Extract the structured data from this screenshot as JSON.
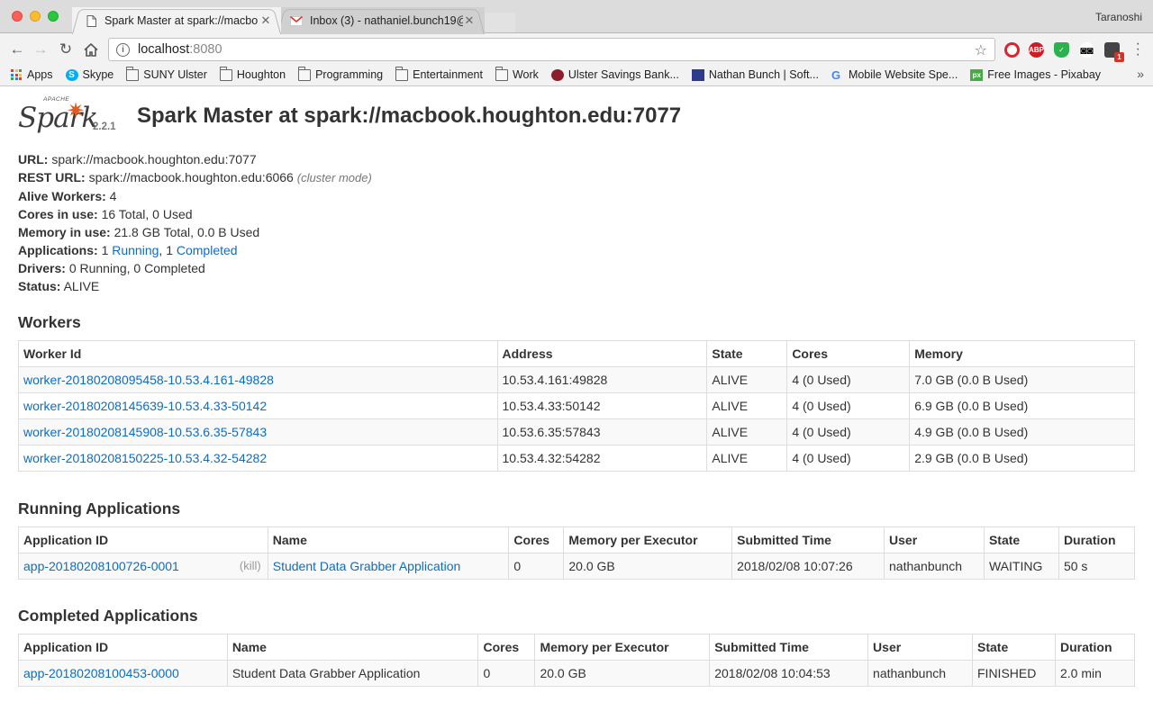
{
  "browser": {
    "tabs": [
      {
        "title": "Spark Master at spark://macbo",
        "favicon": "page-icon"
      },
      {
        "title": "Inbox (3) - nathaniel.bunch19@",
        "favicon": "gmail-icon"
      }
    ],
    "profile_name": "Taranoshi",
    "address": {
      "host": "localhost",
      "port": ":8080"
    },
    "bookmarks": [
      {
        "label": "Apps",
        "icon": "apps-grid-icon"
      },
      {
        "label": "Skype",
        "icon": "skype-icon"
      },
      {
        "label": "SUNY Ulster",
        "icon": "folder-icon"
      },
      {
        "label": "Houghton",
        "icon": "folder-icon"
      },
      {
        "label": "Programming",
        "icon": "folder-icon"
      },
      {
        "label": "Entertainment",
        "icon": "folder-icon"
      },
      {
        "label": "Work",
        "icon": "folder-icon"
      },
      {
        "label": "Ulster Savings Bank...",
        "icon": "bank-icon"
      },
      {
        "label": "Nathan Bunch | Soft...",
        "icon": "site-icon"
      },
      {
        "label": "Mobile Website Spe...",
        "icon": "google-icon"
      },
      {
        "label": "Free Images - Pixabay",
        "icon": "pixabay-icon"
      }
    ],
    "extension_badge": "1"
  },
  "spark": {
    "logo_apache": "APACHE",
    "logo_word": "Spark",
    "version": "2.2.1",
    "title": "Spark Master at spark://macbook.houghton.edu:7077"
  },
  "summary": {
    "url_label": "URL:",
    "url": "spark://macbook.houghton.edu:7077",
    "rest_label": "REST URL:",
    "rest": "spark://macbook.houghton.edu:6066",
    "rest_mode": "(cluster mode)",
    "alive_label": "Alive Workers:",
    "alive": "4",
    "cores_label": "Cores in use:",
    "cores": "16 Total, 0 Used",
    "memory_label": "Memory in use:",
    "memory": "21.8 GB Total, 0.0 B Used",
    "apps_label": "Applications:",
    "apps_running_count": "1",
    "apps_running": "Running",
    "apps_sep": ",",
    "apps_completed_count": "1",
    "apps_completed": "Completed",
    "drivers_label": "Drivers:",
    "drivers": "0 Running, 0 Completed",
    "status_label": "Status:",
    "status": "ALIVE"
  },
  "workers": {
    "heading": "Workers",
    "columns": [
      "Worker Id",
      "Address",
      "State",
      "Cores",
      "Memory"
    ],
    "rows": [
      [
        "worker-20180208095458-10.53.4.161-49828",
        "10.53.4.161:49828",
        "ALIVE",
        "4 (0 Used)",
        "7.0 GB (0.0 B Used)"
      ],
      [
        "worker-20180208145639-10.53.4.33-50142",
        "10.53.4.33:50142",
        "ALIVE",
        "4 (0 Used)",
        "6.9 GB (0.0 B Used)"
      ],
      [
        "worker-20180208145908-10.53.6.35-57843",
        "10.53.6.35:57843",
        "ALIVE",
        "4 (0 Used)",
        "4.9 GB (0.0 B Used)"
      ],
      [
        "worker-20180208150225-10.53.4.32-54282",
        "10.53.4.32:54282",
        "ALIVE",
        "4 (0 Used)",
        "2.9 GB (0.0 B Used)"
      ]
    ]
  },
  "running": {
    "heading": "Running Applications",
    "columns": [
      "Application ID",
      "Name",
      "Cores",
      "Memory per Executor",
      "Submitted Time",
      "User",
      "State",
      "Duration"
    ],
    "rows": [
      [
        "app-20180208100726-0001",
        "Student Data Grabber Application",
        "0",
        "20.0 GB",
        "2018/02/08 10:07:26",
        "nathanbunch",
        "WAITING",
        "50 s"
      ]
    ],
    "kill_label": "(kill)"
  },
  "completed": {
    "heading": "Completed Applications",
    "columns": [
      "Application ID",
      "Name",
      "Cores",
      "Memory per Executor",
      "Submitted Time",
      "User",
      "State",
      "Duration"
    ],
    "rows": [
      [
        "app-20180208100453-0000",
        "Student Data Grabber Application",
        "0",
        "20.0 GB",
        "2018/02/08 10:04:53",
        "nathanbunch",
        "FINISHED",
        "2.0 min"
      ]
    ]
  }
}
